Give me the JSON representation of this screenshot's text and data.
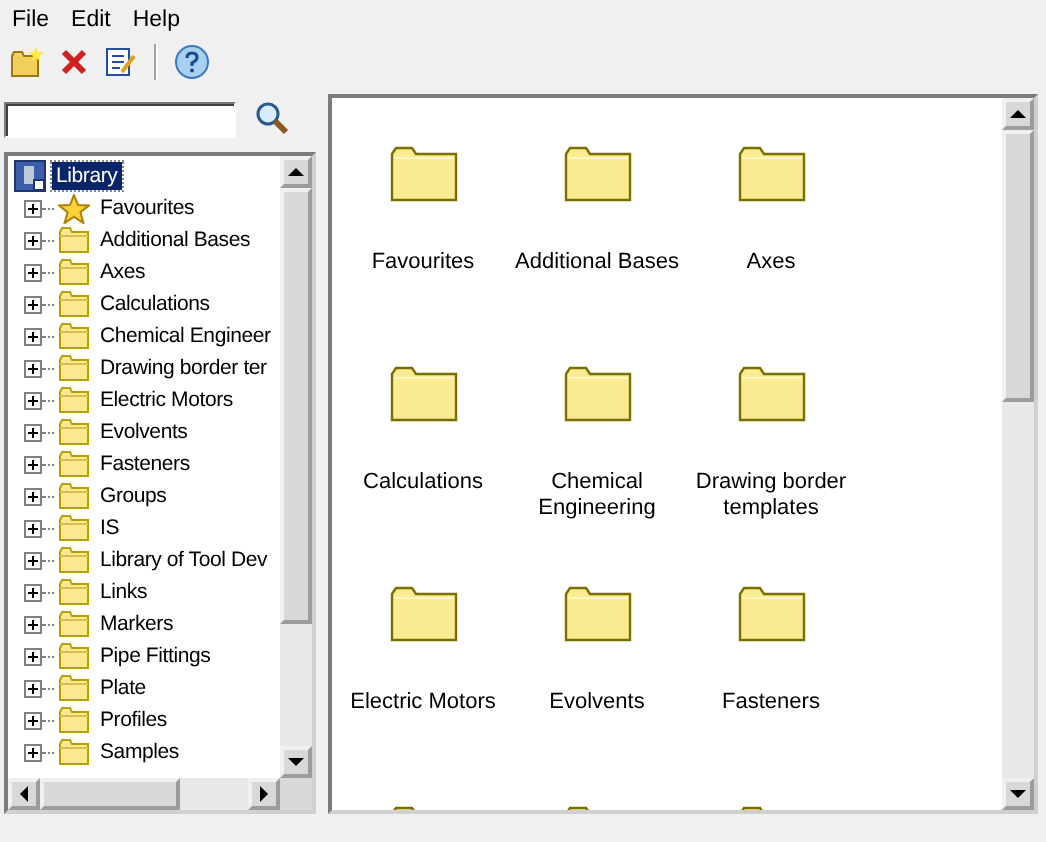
{
  "menu": [
    "File",
    "Edit",
    "Help"
  ],
  "toolbar": [
    {
      "kind": "new"
    },
    {
      "kind": "delete"
    },
    {
      "kind": "edit"
    },
    {
      "kind": "separator"
    },
    {
      "kind": "help"
    }
  ],
  "tree": {
    "root": {
      "label": "Library",
      "kind": "library",
      "selected": true
    },
    "children": [
      {
        "label": "Favourites",
        "kind": "star",
        "selected": false
      },
      {
        "label": "Additional Bases",
        "kind": "folder",
        "selected": false
      },
      {
        "label": "Axes",
        "kind": "folder",
        "selected": false
      },
      {
        "label": "Calculations",
        "kind": "folder",
        "selected": false
      },
      {
        "label": "Chemical Engineer",
        "kind": "folder",
        "selected": false
      },
      {
        "label": "Drawing border ter",
        "kind": "folder",
        "selected": false
      },
      {
        "label": "Electric Motors",
        "kind": "folder",
        "selected": false
      },
      {
        "label": "Evolvents",
        "kind": "folder",
        "selected": false
      },
      {
        "label": "Fasteners",
        "kind": "folder",
        "selected": false
      },
      {
        "label": "Groups",
        "kind": "folder",
        "selected": false
      },
      {
        "label": "IS",
        "kind": "folder",
        "selected": false
      },
      {
        "label": "Library of Tool Dev",
        "kind": "folder",
        "selected": false
      },
      {
        "label": "Links",
        "kind": "folder",
        "selected": false
      },
      {
        "label": "Markers",
        "kind": "folder",
        "selected": false
      },
      {
        "label": "Pipe Fittings",
        "kind": "folder",
        "selected": false
      },
      {
        "label": "Plate",
        "kind": "folder",
        "selected": false
      },
      {
        "label": "Profiles",
        "kind": "folder",
        "selected": false
      },
      {
        "label": "Samples",
        "kind": "folder",
        "selected": false
      }
    ]
  },
  "items": [
    {
      "label": "Favourites",
      "kind": "folder"
    },
    {
      "label": "Additional Bases",
      "kind": "folder"
    },
    {
      "label": "Axes",
      "kind": "folder"
    },
    {
      "label": "Calculations",
      "kind": "folder"
    },
    {
      "label": "Chemical Engineering",
      "kind": "folder"
    },
    {
      "label": "Drawing border templates",
      "kind": "folder"
    },
    {
      "label": "Electric Motors",
      "kind": "folder"
    },
    {
      "label": "Evolvents",
      "kind": "folder"
    },
    {
      "label": "Fasteners",
      "kind": "folder"
    },
    {
      "kind": "folder"
    },
    {
      "kind": "folder"
    },
    {
      "kind": "folder"
    }
  ]
}
